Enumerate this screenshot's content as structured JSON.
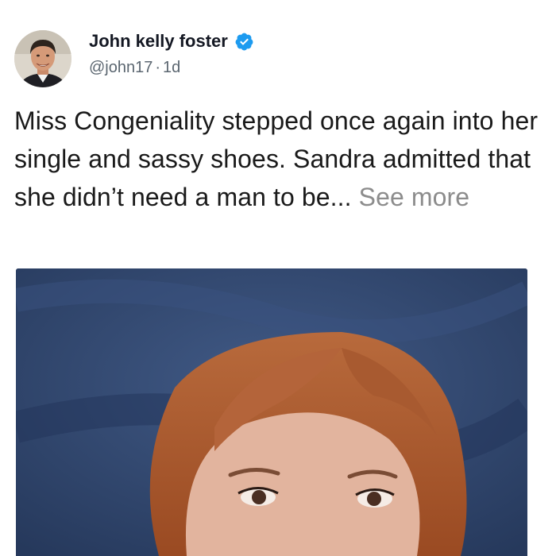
{
  "author": {
    "display_name": "John kelly foster",
    "handle": "@john17",
    "separator": "·",
    "time_ago": "1d",
    "verified": true
  },
  "tweet": {
    "text": "Miss Congeniality stepped once again into her single and sassy shoes. Sandra admitted that she didn’t need a man to be... ",
    "see_more_label": "See more"
  },
  "colors": {
    "verified_badge": "#1d9bf0",
    "see_more": "#8c8c8c",
    "media_background": "#2f466e",
    "hair": "#a9552a"
  },
  "icons": {
    "verified": "verified-check-badge-icon"
  }
}
